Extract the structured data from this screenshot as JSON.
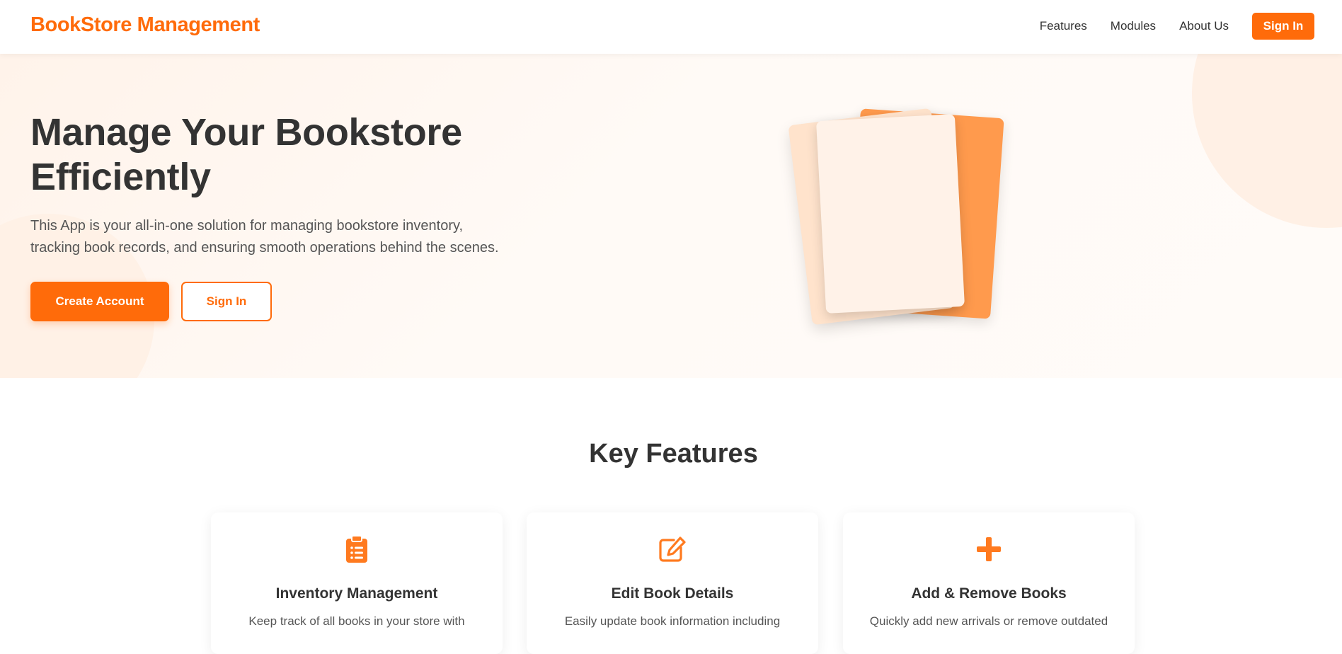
{
  "header": {
    "brand": "BookStore Management",
    "nav": [
      "Features",
      "Modules",
      "About Us"
    ],
    "sign_in_label": "Sign In"
  },
  "hero": {
    "title": "Manage Your Bookstore Efficiently",
    "description": "This App is your all-in-one solution for managing bookstore inventory, tracking book records, and ensuring smooth operations behind the scenes.",
    "create_account_label": "Create Account",
    "sign_in_label": "Sign In"
  },
  "features": {
    "heading": "Key Features",
    "cards": [
      {
        "icon": "clipboard-list-icon",
        "title": "Inventory Management",
        "description": "Keep track of all books in your store with"
      },
      {
        "icon": "edit-icon",
        "title": "Edit Book Details",
        "description": "Easily update book information including"
      },
      {
        "icon": "plus-icon",
        "title": "Add & Remove Books",
        "description": "Quickly add new arrivals or remove outdated"
      }
    ]
  },
  "colors": {
    "accent": "#ff6b0a",
    "text_dark": "#333333",
    "text_muted": "#555555",
    "hero_bg": "#fff7f1"
  }
}
